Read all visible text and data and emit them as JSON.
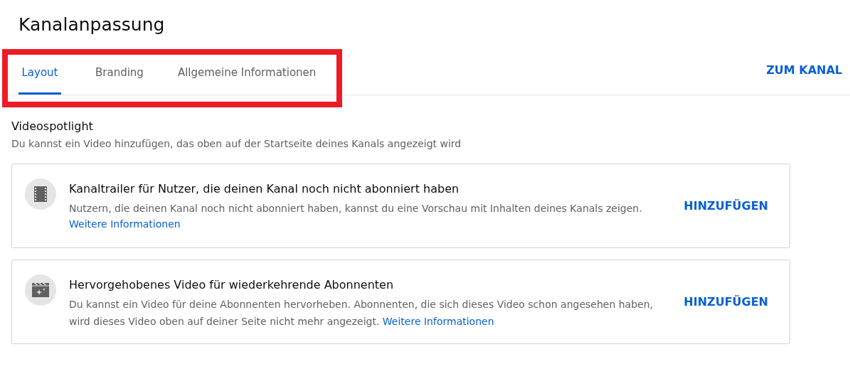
{
  "page_title": "Kanalanpassung",
  "tab_bar": {
    "highlighted": true,
    "tabs": [
      {
        "label": "Layout",
        "selected": true
      },
      {
        "label": "Branding",
        "selected": false
      },
      {
        "label": "Allgemeine Informationen",
        "selected": false
      }
    ],
    "action": "ZUM KANAL"
  },
  "section": {
    "title": "Videospotlight",
    "subtitle": "Du kannst ein Video hinzufügen, das oben auf der Startseite deines Kanals angezeigt wird"
  },
  "cards": [
    {
      "kind": "link-below",
      "title": "Kanaltrailer für Nutzer, die deinen Kanal noch nicht abonniert haben",
      "description": "Nutzern, die deinen Kanal noch nicht abonniert haben, kannst du eine Vorschau mit Inhalten deines Kanals zeigen.",
      "link": "Weitere Informationen",
      "button": "HINZUFÜGEN"
    },
    {
      "kind": "link-inline",
      "title": "Hervorgehobenes Video für wiederkehrende Abonnenten",
      "description": "Du kannst ein Video für deine Abonnenten hervorheben. Abonnenten, die sich dieses Video schon angesehen haben, wird dieses Video oben auf deiner Seite nicht mehr angezeigt.",
      "link": "Weitere Informationen",
      "button": "HINZUFÜGEN"
    }
  ]
}
